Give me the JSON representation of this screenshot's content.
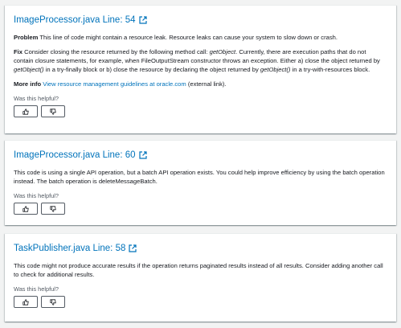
{
  "cards": [
    {
      "title": "ImageProcessor.java Line: 54",
      "problem_label": "Problem",
      "problem_text": "This line of code might contain a resource leak. Resource leaks can cause your system to slow down or crash.",
      "fix_label": "Fix",
      "fix_part1": "Consider closing the resource returned by the following method call:",
      "fix_method1": "getObject",
      "fix_part2": ". Currently, there are execution paths that do not contain closure statements, for example, when FileOutputStream constructor throws an exception. Either a) close the object returned by",
      "fix_method2": "getObject()",
      "fix_part3": "in a try-finally block or b) close the resource by declaring the object returned by",
      "fix_method3": "getObject()",
      "fix_part4": "in a try-with-resources block.",
      "more_label": "More info",
      "more_link": "View resource management guidelines at oracle.com",
      "more_suffix": "(external link).",
      "helpful": "Was this helpful?"
    },
    {
      "title": "ImageProcessor.java Line: 60",
      "text": "This code is using a single API operation, but a batch API operation exists. You could help improve efficiency by using the batch operation instead. The batch operation is deleteMessageBatch.",
      "helpful": "Was this helpful?"
    },
    {
      "title": "TaskPublisher.java Line: 58",
      "text": "This code might not produce accurate results if the operation returns paginated results instead of all results. Consider adding another call to check for additional results.",
      "helpful": "Was this helpful?"
    }
  ],
  "icons": {
    "external": "external-link-icon",
    "thumbs_up": "thumbs-up-icon",
    "thumbs_down": "thumbs-down-icon"
  },
  "colors": {
    "link": "#0073bb",
    "background": "#f2f3f3",
    "card": "#ffffff"
  }
}
